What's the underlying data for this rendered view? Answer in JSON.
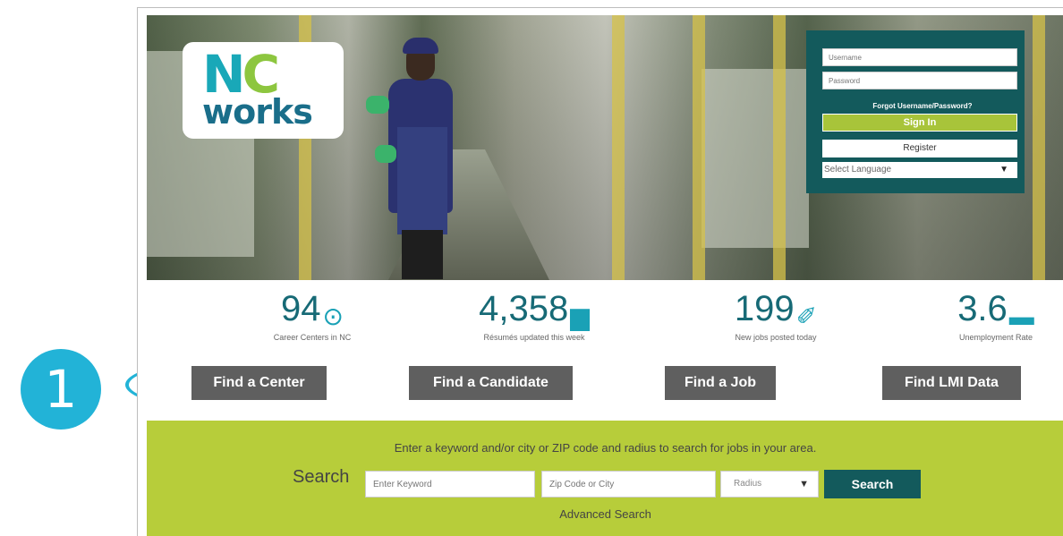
{
  "logo": {
    "line1_n": "N",
    "line1_c": "C",
    "line2": "works"
  },
  "login": {
    "username_placeholder": "Username",
    "password_placeholder": "Password",
    "forgot_label": "Forgot Username/Password?",
    "signin_label": "Sign In",
    "register_label": "Register",
    "language_label": "Select Language",
    "language_arrow": "▼"
  },
  "stats": [
    {
      "value": "94",
      "icon": "target-icon",
      "glyph": "⊙",
      "caption": "Career Centers in NC",
      "button": "Find a Center"
    },
    {
      "value": "4,358",
      "icon": "document-icon",
      "glyph": "▆",
      "caption": "Résumés updated this week",
      "button": "Find a Candidate"
    },
    {
      "value": "199",
      "icon": "pushpin-icon",
      "glyph": "✐",
      "caption": "New jobs posted today",
      "button": "Find a Job"
    },
    {
      "value": "3.6",
      "icon": "briefcase-icon",
      "glyph": "▬",
      "caption": "Unemployment Rate",
      "button": "Find LMI Data"
    }
  ],
  "search": {
    "message": "Enter a keyword and/or city or ZIP code and radius to search for jobs in your area.",
    "label": "Search",
    "keyword_placeholder": "Enter Keyword",
    "location_placeholder": "Zip Code or City",
    "radius_label": "Radius",
    "radius_arrow": "▼",
    "button": "Search",
    "advanced": "Advanced Search"
  },
  "annotation": {
    "step_number": "1"
  },
  "colors": {
    "teal": "#135a5c",
    "lime": "#b7cd3a",
    "accent_blue": "#22b3d7",
    "button_gray": "#5f5f5f"
  }
}
